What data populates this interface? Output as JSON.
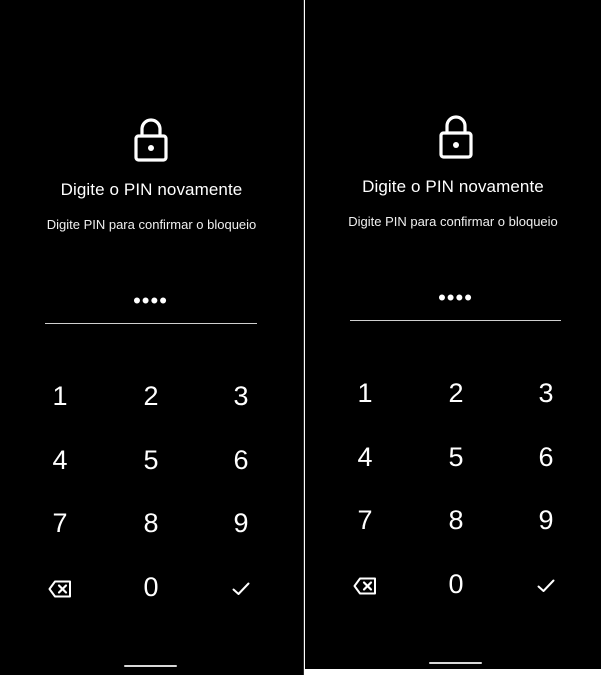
{
  "screens": [
    {
      "title": "Digite o PIN novamente",
      "subtitle": "Digite PIN para confirmar o bloqueio",
      "pin_masked": "••••",
      "keys": [
        "1",
        "2",
        "3",
        "4",
        "5",
        "6",
        "7",
        "8",
        "9",
        "0"
      ],
      "icons": {
        "lock": "lock-icon",
        "backspace": "backspace-icon",
        "confirm": "checkmark-icon"
      }
    },
    {
      "title": "Digite o PIN novamente",
      "subtitle": "Digite PIN para confirmar o bloqueio",
      "pin_masked": "••••",
      "keys": [
        "1",
        "2",
        "3",
        "4",
        "5",
        "6",
        "7",
        "8",
        "9",
        "0"
      ],
      "icons": {
        "lock": "lock-icon",
        "backspace": "backspace-icon",
        "confirm": "checkmark-icon"
      }
    }
  ],
  "colors": {
    "background": "#000000",
    "text": "#ffffff",
    "divider": "#d0d0d0"
  }
}
